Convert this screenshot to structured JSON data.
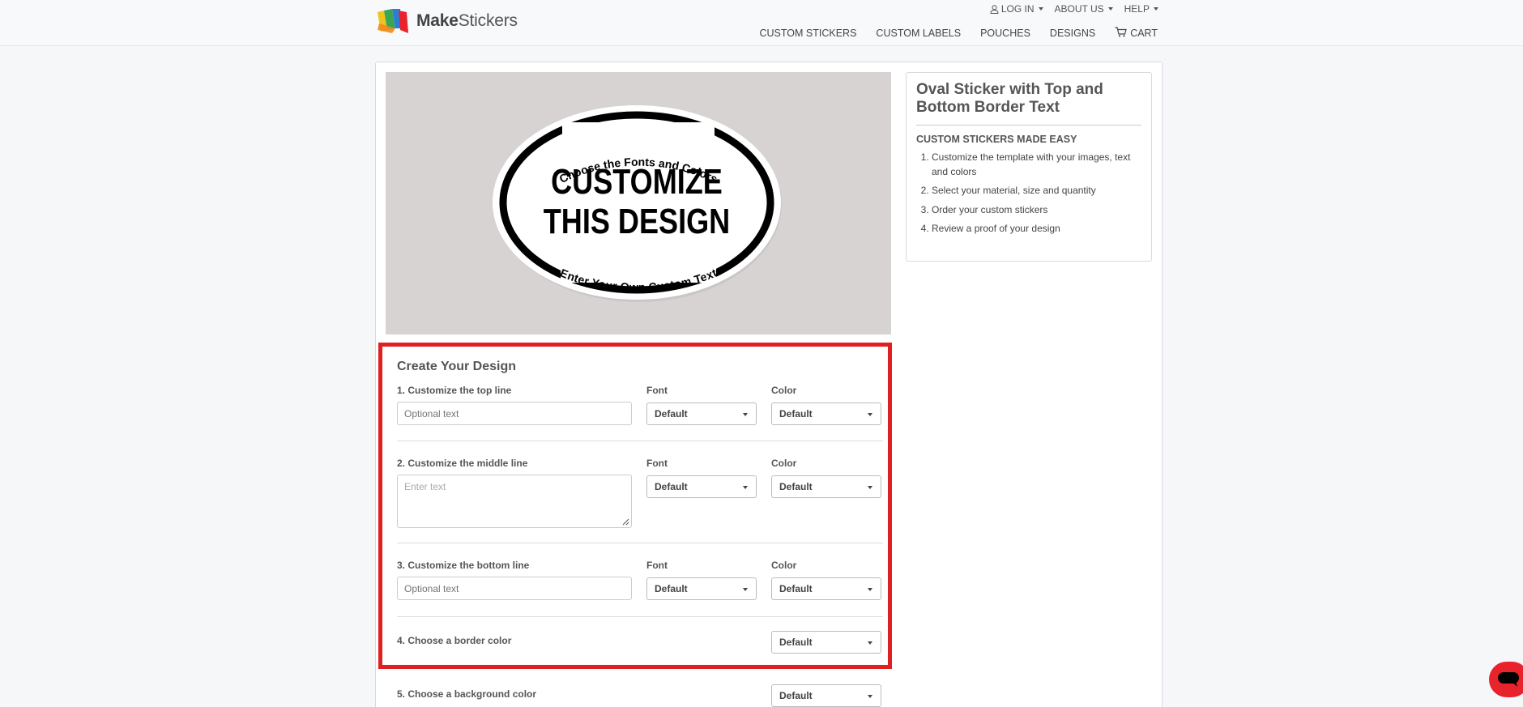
{
  "brand": {
    "name_bold": "Make",
    "name_rest": "Stickers"
  },
  "topnav": [
    {
      "label": "LOG IN",
      "icon": "user-icon"
    },
    {
      "label": "ABOUT US"
    },
    {
      "label": "HELP"
    }
  ],
  "mainnav": {
    "custom_stickers": "CUSTOM STICKERS",
    "custom_labels": "CUSTOM LABELS",
    "pouches": "POUCHES",
    "designs": "DESIGNS",
    "cart": "CART"
  },
  "preview": {
    "top_text": "Choose the Fonts and Colors",
    "middle_line1": "CUSTOMIZE",
    "middle_line2": "THIS DESIGN",
    "bottom_text": "Enter Your Own Custom Text"
  },
  "info": {
    "title": "Oval Sticker with Top and Bottom Border Text",
    "subtitle": "CUSTOM STICKERS MADE EASY",
    "steps": [
      "Customize the template with your images, text and colors",
      "Select your material, size and quantity",
      "Order your custom stickers",
      "Review a proof of your design"
    ]
  },
  "design": {
    "title": "Create Your Design",
    "font_label": "Font",
    "color_label": "Color",
    "rows": [
      {
        "label": "1. Customize the top line",
        "placeholder": "Optional text",
        "font": "Default",
        "color": "Default"
      },
      {
        "label": "2. Customize the middle line",
        "placeholder": "Enter text",
        "font": "Default",
        "color": "Default"
      },
      {
        "label": "3. Customize the bottom line",
        "placeholder": "Optional text",
        "font": "Default",
        "color": "Default"
      }
    ],
    "border": {
      "label": "4. Choose a border color",
      "value": "Default"
    },
    "background": {
      "label": "5. Choose a background color",
      "value": "Default"
    }
  },
  "colors": {
    "highlight": "#e02020",
    "chat": "#e8232b",
    "preview_bg": "#d7d3d2"
  }
}
